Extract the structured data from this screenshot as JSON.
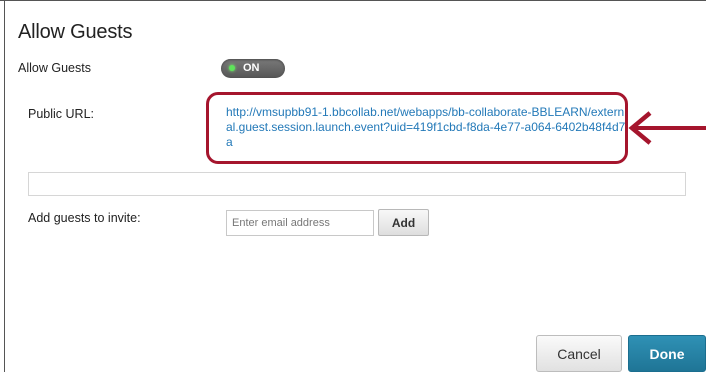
{
  "dialog": {
    "title": "Allow Guests"
  },
  "allow_guests": {
    "label": "Allow Guests",
    "toggle_text": "ON",
    "enabled": true
  },
  "public_url": {
    "label": "Public URL:",
    "url": "http://vmsupbb91-1.bbcollab.net/webapps/bb-collaborate-BBLEARN/external.guest.session.launch.event?uid=419f1cbd-f8da-4e77-a064-6402b48f4d7a"
  },
  "invite": {
    "label": "Add guests to invite:",
    "placeholder": "Enter email address",
    "add_label": "Add"
  },
  "footer": {
    "cancel_label": "Cancel",
    "done_label": "Done"
  },
  "colors": {
    "highlight_border": "#a5152d",
    "link": "#2379b8",
    "done_button": "#1f7596",
    "toggle_indicator": "#5ee35a"
  }
}
